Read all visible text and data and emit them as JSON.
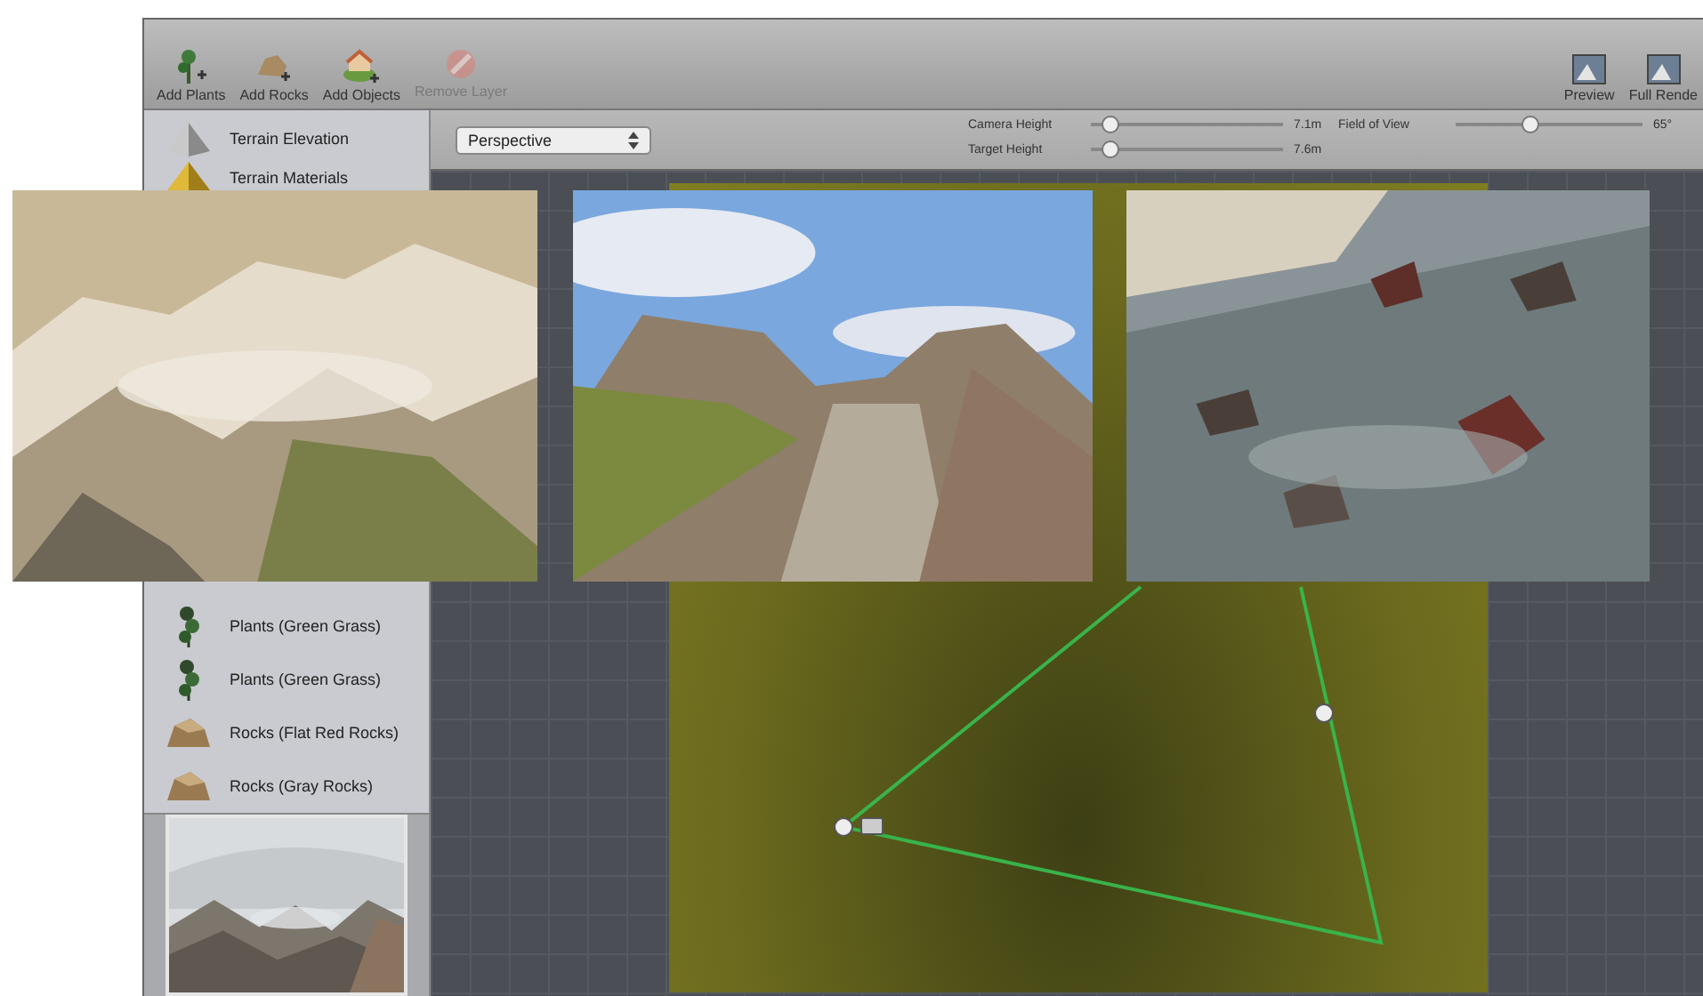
{
  "toolbar": {
    "left_buttons": [
      {
        "label": "Add Plants",
        "kind": "plant",
        "disabled": false
      },
      {
        "label": "Add Rocks",
        "kind": "rock",
        "disabled": false
      },
      {
        "label": "Add Objects",
        "kind": "house",
        "disabled": false
      },
      {
        "label": "Remove Layer",
        "kind": "remove",
        "disabled": true
      }
    ],
    "right_buttons": [
      {
        "label": "Preview"
      },
      {
        "label": "Full Rende"
      }
    ]
  },
  "sidebar": {
    "upper_items": [
      {
        "label": "Terrain Elevation",
        "kind": "elevation"
      },
      {
        "label": "Terrain Materials",
        "kind": "materials"
      }
    ],
    "lower_items": [
      {
        "label": "Plants (Green Grass)",
        "kind": "plant"
      },
      {
        "label": "Plants (Green Grass)",
        "kind": "plant"
      },
      {
        "label": "Rocks (Flat Red Rocks)",
        "kind": "rock"
      },
      {
        "label": "Rocks (Gray Rocks)",
        "kind": "rock"
      }
    ]
  },
  "view_bar": {
    "view_select": "Perspective",
    "sliders": [
      {
        "label": "Camera Height",
        "level": 0.1,
        "reading": "7.1m"
      },
      {
        "label": "Target Height",
        "level": 0.1,
        "reading": "7.6m"
      },
      {
        "label": "Field of View",
        "level": 0.4,
        "reading": "65°"
      }
    ]
  }
}
